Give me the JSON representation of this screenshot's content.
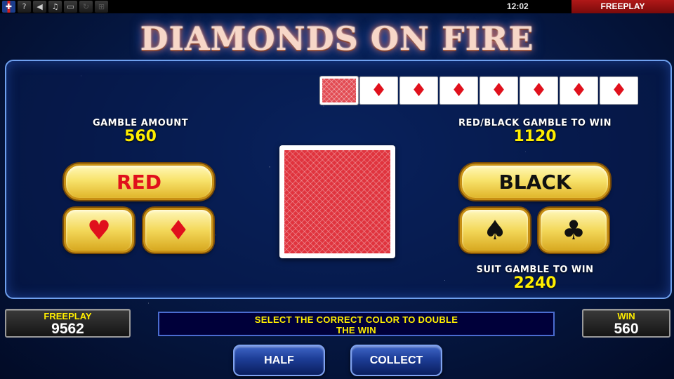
{
  "topbar": {
    "icons": [
      "uk-flag-icon",
      "help-icon",
      "sound-icon",
      "music-icon",
      "fullscreen-icon",
      "refresh-icon",
      "settings-icon"
    ],
    "clock": "12:02",
    "mode_label": "FREEPLAY"
  },
  "logo": {
    "text": "DIAMONDS ON FIRE"
  },
  "history": {
    "cards": [
      "back",
      "diamond",
      "diamond",
      "diamond",
      "diamond",
      "diamond",
      "diamond",
      "diamond"
    ]
  },
  "gamble": {
    "amount_label": "GAMBLE AMOUNT",
    "amount_value": "560",
    "color_win_label": "RED/BLACK GAMBLE TO WIN",
    "color_win_value": "1120",
    "suit_win_label": "SUIT GAMBLE TO WIN",
    "suit_win_value": "2240"
  },
  "buttons": {
    "red": "RED",
    "black": "BLACK",
    "half": "HALF",
    "collect": "COLLECT"
  },
  "suits": {
    "heart": "♥",
    "diamond": "♦",
    "spade": "♠",
    "club": "♣"
  },
  "footer": {
    "credit_label": "FREEPLAY",
    "credit_value": "9562",
    "message_line1": "SELECT THE CORRECT COLOR TO DOUBLE",
    "message_line2": "THE WIN",
    "win_label": "WIN",
    "win_value": "560"
  },
  "colors": {
    "accent_yellow": "#ffee00",
    "suit_red": "#e0101c",
    "card_back_red": "#e0343e",
    "panel_border": "#6fa0ee"
  }
}
